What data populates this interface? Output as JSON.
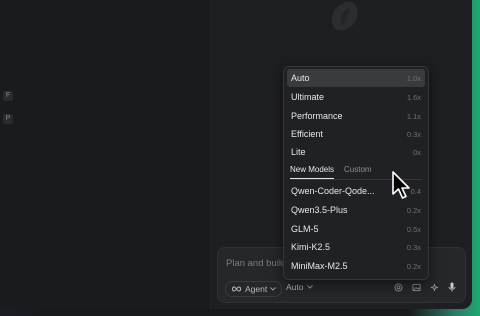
{
  "sidebar": {
    "shortcuts": [
      "F",
      "P"
    ]
  },
  "composer": {
    "placeholder": "Plan and build, ...",
    "mode_label": "Agent",
    "model_label": "Auto"
  },
  "model_menu": {
    "tiers": [
      {
        "label": "Auto",
        "multiplier": "1.0x",
        "selected": true
      },
      {
        "label": "Ultimate",
        "multiplier": "1.6x"
      },
      {
        "label": "Performance",
        "multiplier": "1.1x"
      },
      {
        "label": "Efficient",
        "multiplier": "0.3x"
      },
      {
        "label": "Lite",
        "multiplier": "0x"
      }
    ],
    "tabs": [
      {
        "label": "New Models",
        "active": true
      },
      {
        "label": "Custom"
      }
    ],
    "models": [
      {
        "label": "Qwen-Coder-Qode...",
        "multiplier": "0.4"
      },
      {
        "label": "Qwen3.5-Plus",
        "multiplier": "0.2x"
      },
      {
        "label": "GLM-5",
        "multiplier": "0.5x"
      },
      {
        "label": "Kimi-K2.5",
        "multiplier": "0.3x"
      },
      {
        "label": "MiniMax-M2.5",
        "multiplier": "0.2x"
      }
    ]
  },
  "colors": {
    "background": "#18191b",
    "menu_bg": "#202124",
    "selected_bg": "#3a3b3f",
    "accent_edge": "#1ea870"
  },
  "icons": [
    "logo-icon",
    "infinity-icon",
    "chevron-down-icon",
    "at-icon",
    "image-icon",
    "sparkle-icon",
    "microphone-icon",
    "mouse-cursor-icon"
  ]
}
